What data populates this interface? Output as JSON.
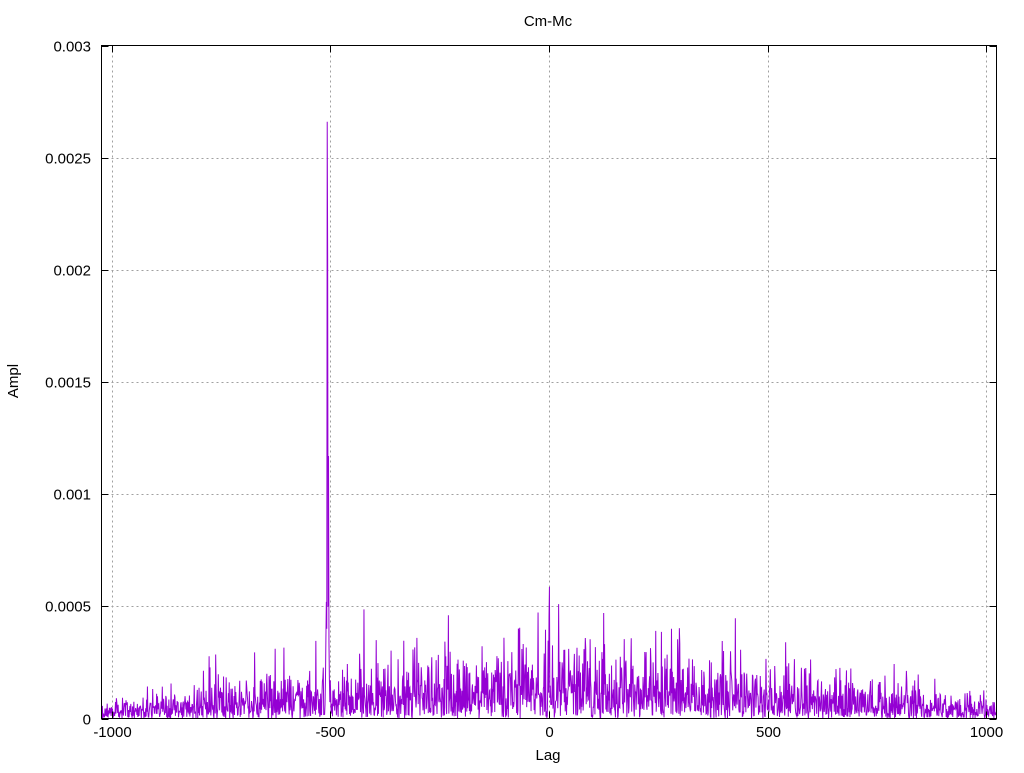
{
  "chart_data": {
    "type": "line",
    "title": "Cm-Mc",
    "xlabel": "Lag",
    "ylabel": "Ampl",
    "xlim": [
      -1023,
      1023
    ],
    "ylim": [
      0,
      0.003
    ],
    "grid": true,
    "legend": "none",
    "series_color": "#9400d3",
    "xticks": [
      {
        "value": -1000,
        "label": "-1000"
      },
      {
        "value": -500,
        "label": "-500"
      },
      {
        "value": 0,
        "label": "0"
      },
      {
        "value": 500,
        "label": "500"
      },
      {
        "value": 1000,
        "label": "1000"
      }
    ],
    "yticks": [
      {
        "value": 0,
        "label": "0"
      },
      {
        "value": 0.0005,
        "label": "0.0005"
      },
      {
        "value": 0.001,
        "label": "0.001"
      },
      {
        "value": 0.0015,
        "label": "0.0015"
      },
      {
        "value": 0.002,
        "label": "0.002"
      },
      {
        "value": 0.0025,
        "label": "0.0025"
      },
      {
        "value": 0.003,
        "label": "0.003"
      }
    ],
    "peaks": [
      [
        -510,
        0.00036
      ],
      [
        -509,
        0.00052
      ],
      [
        -508,
        0.0004
      ],
      [
        -507,
        0.00266
      ],
      [
        -506,
        0.00205
      ],
      [
        -505,
        0.0005
      ],
      [
        -504,
        0.00117
      ],
      [
        -503,
        0.00034
      ],
      [
        -230,
        0.00046
      ],
      [
        0,
        0.00045
      ],
      [
        22,
        0.00051
      ],
      [
        125,
        0.00047
      ],
      [
        280,
        0.0004
      ]
    ],
    "noise_envelope": [
      [
        -1023,
        4e-05
      ],
      [
        -500,
        0.00011
      ],
      [
        0,
        0.00017
      ],
      [
        500,
        0.00011
      ],
      [
        1023,
        4e-05
      ]
    ],
    "noise_seed": 12345
  }
}
